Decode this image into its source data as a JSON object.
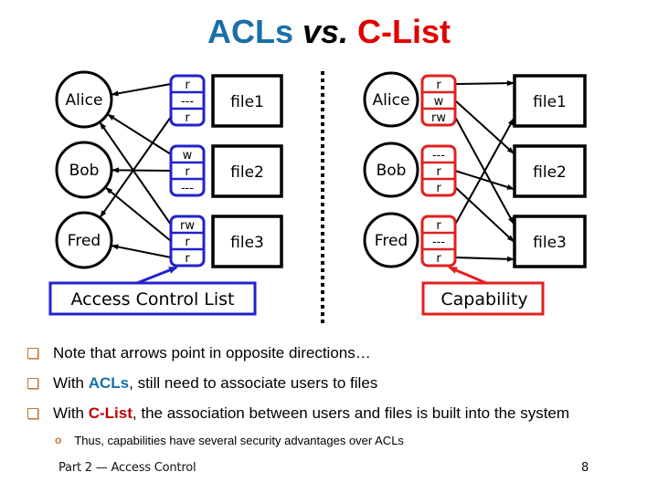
{
  "title": {
    "part1": "ACLs",
    "part2": "vs.",
    "part3": "C-List",
    "colors": {
      "acl": "#1a6fa8",
      "clist": "#e00000"
    }
  },
  "acl_diagram": {
    "label": "Access Control List",
    "accent_color": "#2222cc",
    "users": [
      "Alice",
      "Bob",
      "Fred"
    ],
    "files": [
      {
        "name": "file1",
        "entries": [
          "r",
          "---",
          "r"
        ]
      },
      {
        "name": "file2",
        "entries": [
          "w",
          "r",
          "---"
        ]
      },
      {
        "name": "file3",
        "entries": [
          "rw",
          "r",
          "r"
        ]
      }
    ],
    "arrows_file_entry_to_user": [
      {
        "file": "file1",
        "entry_index": 0,
        "user": "Alice"
      },
      {
        "file": "file1",
        "entry_index": 2,
        "user": "Fred"
      },
      {
        "file": "file2",
        "entry_index": 0,
        "user": "Alice"
      },
      {
        "file": "file2",
        "entry_index": 1,
        "user": "Bob"
      },
      {
        "file": "file3",
        "entry_index": 0,
        "user": "Alice"
      },
      {
        "file": "file3",
        "entry_index": 1,
        "user": "Bob"
      },
      {
        "file": "file3",
        "entry_index": 2,
        "user": "Fred"
      }
    ]
  },
  "clist_diagram": {
    "label": "Capability",
    "accent_color": "#e02020",
    "users": [
      {
        "name": "Alice",
        "entries": [
          "r",
          "w",
          "rw"
        ]
      },
      {
        "name": "Bob",
        "entries": [
          "---",
          "r",
          "r"
        ]
      },
      {
        "name": "Fred",
        "entries": [
          "r",
          "---",
          "r"
        ]
      }
    ],
    "files": [
      "file1",
      "file2",
      "file3"
    ],
    "arrows_user_entry_to_file": [
      {
        "user": "Alice",
        "entry_index": 0,
        "file": "file1"
      },
      {
        "user": "Alice",
        "entry_index": 1,
        "file": "file2"
      },
      {
        "user": "Alice",
        "entry_index": 2,
        "file": "file3"
      },
      {
        "user": "Bob",
        "entry_index": 1,
        "file": "file2"
      },
      {
        "user": "Bob",
        "entry_index": 2,
        "file": "file3"
      },
      {
        "user": "Fred",
        "entry_index": 0,
        "file": "file1"
      },
      {
        "user": "Fred",
        "entry_index": 2,
        "file": "file3"
      }
    ]
  },
  "bullets": [
    {
      "pre": "Note that arrows point in opposite directions…",
      "hl": "",
      "post": ""
    },
    {
      "pre": "With ",
      "hl": "ACLs",
      "post": ", still need to associate users to files"
    },
    {
      "pre": "With ",
      "hl": "C-List",
      "post": ", the association between users and files is built into the system"
    }
  ],
  "sub_bullet": "Thus, capabilities have several security advantages over ACLs",
  "footer": {
    "left": "Part 2 — Access Control",
    "page_number": "8"
  }
}
